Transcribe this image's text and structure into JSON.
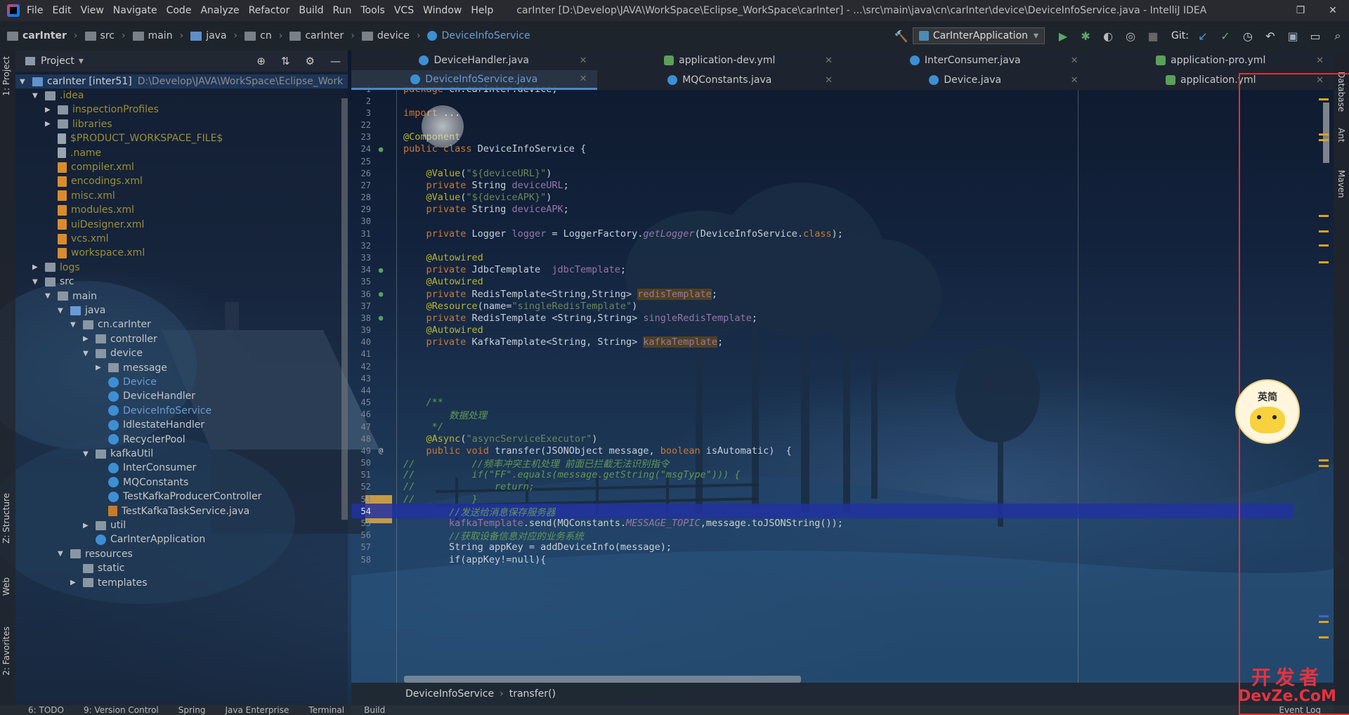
{
  "menu": {
    "items": [
      "File",
      "Edit",
      "View",
      "Navigate",
      "Code",
      "Analyze",
      "Refactor",
      "Build",
      "Run",
      "Tools",
      "VCS",
      "Window",
      "Help"
    ],
    "title": "carInter [D:\\Develop\\JAVA\\WorkSpace\\Eclipse_WorkSpace\\carInter] - ...\\src\\main\\java\\cn\\carInter\\device\\DeviceInfoService.java - IntelliJ IDEA"
  },
  "breadcrumb": [
    "carInter",
    "src",
    "main",
    "java",
    "cn",
    "carInter",
    "device",
    "DeviceInfoService"
  ],
  "toolbar": {
    "run_config": "CarInterApplication",
    "git_label": "Git:"
  },
  "left_tools": {
    "project": "1: Project",
    "structure": "Z: Structure",
    "web": "Web",
    "favorites": "2: Favorites"
  },
  "right_tools": {
    "database": "Database",
    "ant": "Ant",
    "maven": "Maven"
  },
  "project_panel": {
    "title": "Project",
    "root_label": "carInter [inter51]",
    "root_path": "D:\\Develop\\JAVA\\WorkSpace\\Eclipse_Work",
    "tree": [
      {
        "label": ".idea",
        "level": 1,
        "arrow": "▼",
        "icon": "folder",
        "style": "olive"
      },
      {
        "label": "inspectionProfiles",
        "level": 2,
        "arrow": "▶",
        "icon": "folder",
        "style": "olive"
      },
      {
        "label": "libraries",
        "level": 2,
        "arrow": "▶",
        "icon": "folder",
        "style": "olive"
      },
      {
        "label": "$PRODUCT_WORKSPACE_FILE$",
        "level": 2,
        "arrow": "",
        "icon": "file",
        "style": "olive"
      },
      {
        "label": ".name",
        "level": 2,
        "arrow": "",
        "icon": "file",
        "style": "olive"
      },
      {
        "label": "compiler.xml",
        "level": 2,
        "arrow": "",
        "icon": "xml",
        "style": "olive"
      },
      {
        "label": "encodings.xml",
        "level": 2,
        "arrow": "",
        "icon": "xml",
        "style": "olive"
      },
      {
        "label": "misc.xml",
        "level": 2,
        "arrow": "",
        "icon": "xml",
        "style": "olive"
      },
      {
        "label": "modules.xml",
        "level": 2,
        "arrow": "",
        "icon": "xml",
        "style": "olive"
      },
      {
        "label": "uiDesigner.xml",
        "level": 2,
        "arrow": "",
        "icon": "xml",
        "style": "olive"
      },
      {
        "label": "vcs.xml",
        "level": 2,
        "arrow": "",
        "icon": "xml",
        "style": "olive"
      },
      {
        "label": "workspace.xml",
        "level": 2,
        "arrow": "",
        "icon": "xml",
        "style": "olive"
      },
      {
        "label": "logs",
        "level": 1,
        "arrow": "▶",
        "icon": "folder",
        "style": "olive"
      },
      {
        "label": "src",
        "level": 1,
        "arrow": "▼",
        "icon": "folder",
        "style": "plain"
      },
      {
        "label": "main",
        "level": 2,
        "arrow": "▼",
        "icon": "folder",
        "style": "plain"
      },
      {
        "label": "java",
        "level": 3,
        "arrow": "▼",
        "icon": "folder-src",
        "style": "plain"
      },
      {
        "label": "cn.carInter",
        "level": 4,
        "arrow": "▼",
        "icon": "folder",
        "style": "plain"
      },
      {
        "label": "controller",
        "level": 5,
        "arrow": "▶",
        "icon": "folder",
        "style": "plain"
      },
      {
        "label": "device",
        "level": 5,
        "arrow": "▼",
        "icon": "folder",
        "style": "plain"
      },
      {
        "label": "message",
        "level": 6,
        "arrow": "▶",
        "icon": "folder",
        "style": "plain"
      },
      {
        "label": "Device",
        "level": 6,
        "arrow": "",
        "icon": "cls",
        "style": "blue"
      },
      {
        "label": "DeviceHandler",
        "level": 6,
        "arrow": "",
        "icon": "cls",
        "style": "plain"
      },
      {
        "label": "DeviceInfoService",
        "level": 6,
        "arrow": "",
        "icon": "cls",
        "style": "blue"
      },
      {
        "label": "IdlestateHandler",
        "level": 6,
        "arrow": "",
        "icon": "cls",
        "style": "plain"
      },
      {
        "label": "RecyclerPool",
        "level": 6,
        "arrow": "",
        "icon": "cls",
        "style": "plain"
      },
      {
        "label": "kafkaUtil",
        "level": 5,
        "arrow": "▼",
        "icon": "folder",
        "style": "plain"
      },
      {
        "label": "InterConsumer",
        "level": 6,
        "arrow": "",
        "icon": "cls",
        "style": "plain"
      },
      {
        "label": "MQConstants",
        "level": 6,
        "arrow": "",
        "icon": "cls",
        "style": "plain"
      },
      {
        "label": "TestKafkaProducerController",
        "level": 6,
        "arrow": "",
        "icon": "cls",
        "style": "plain"
      },
      {
        "label": "TestKafkaTaskService.java",
        "level": 6,
        "arrow": "",
        "icon": "java",
        "style": "plain"
      },
      {
        "label": "util",
        "level": 5,
        "arrow": "▶",
        "icon": "folder",
        "style": "plain"
      },
      {
        "label": "CarInterApplication",
        "level": 5,
        "arrow": "",
        "icon": "cls",
        "style": "plain"
      },
      {
        "label": "resources",
        "level": 3,
        "arrow": "▼",
        "icon": "folder",
        "style": "plain"
      },
      {
        "label": "static",
        "level": 4,
        "arrow": "",
        "icon": "folder",
        "style": "plain"
      },
      {
        "label": "templates",
        "level": 4,
        "arrow": "▶",
        "icon": "folder",
        "style": "plain"
      }
    ]
  },
  "tabs_row1": [
    {
      "label": "DeviceHandler.java",
      "icon": "cls",
      "active": false
    },
    {
      "label": "application-dev.yml",
      "icon": "yml",
      "active": false
    },
    {
      "label": "InterConsumer.java",
      "icon": "cls",
      "active": false
    },
    {
      "label": "application-pro.yml",
      "icon": "yml",
      "active": false
    }
  ],
  "tabs_row2": [
    {
      "label": "DeviceInfoService.java",
      "icon": "cls",
      "active": true
    },
    {
      "label": "MQConstants.java",
      "icon": "cls",
      "active": false
    },
    {
      "label": "Device.java",
      "icon": "cls",
      "active": false
    },
    {
      "label": "application.yml",
      "icon": "yml",
      "active": false
    }
  ],
  "code_lines": [
    {
      "n": "1",
      "parts": [
        [
          "kw",
          "package "
        ],
        [
          "p",
          "cn.carInter.device;"
        ]
      ]
    },
    {
      "n": "2",
      "parts": []
    },
    {
      "n": "3",
      "parts": [
        [
          "kw",
          "import "
        ],
        [
          "p",
          "..."
        ]
      ]
    },
    {
      "n": "22",
      "parts": []
    },
    {
      "n": "23",
      "parts": [
        [
          "ann",
          "@Component"
        ]
      ]
    },
    {
      "n": "24",
      "parts": [
        [
          "kw",
          "public class "
        ],
        [
          "p",
          "DeviceInfoService {"
        ]
      ],
      "mark": "●"
    },
    {
      "n": "25",
      "parts": []
    },
    {
      "n": "26",
      "parts": [
        [
          "p",
          "    "
        ],
        [
          "ann",
          "@Value"
        ],
        [
          "p",
          "("
        ],
        [
          "str",
          "\"${deviceURL}\""
        ],
        [
          "p",
          ")"
        ]
      ]
    },
    {
      "n": "27",
      "parts": [
        [
          "p",
          "    "
        ],
        [
          "kw",
          "private "
        ],
        [
          "p",
          "String "
        ],
        [
          "fld",
          "deviceURL"
        ],
        [
          "p",
          ";"
        ]
      ]
    },
    {
      "n": "28",
      "parts": [
        [
          "p",
          "    "
        ],
        [
          "ann",
          "@Value"
        ],
        [
          "p",
          "("
        ],
        [
          "str",
          "\"${deviceAPK}\""
        ],
        [
          "p",
          ")"
        ]
      ]
    },
    {
      "n": "29",
      "parts": [
        [
          "p",
          "    "
        ],
        [
          "kw",
          "private "
        ],
        [
          "p",
          "String "
        ],
        [
          "fld",
          "deviceAPK"
        ],
        [
          "p",
          ";"
        ]
      ]
    },
    {
      "n": "30",
      "parts": []
    },
    {
      "n": "31",
      "parts": [
        [
          "p",
          "    "
        ],
        [
          "kw",
          "private "
        ],
        [
          "p",
          "Logger "
        ],
        [
          "fld",
          "logger"
        ],
        [
          "p",
          " = LoggerFactory."
        ],
        [
          "ital",
          "getLogger"
        ],
        [
          "p",
          "(DeviceInfoService."
        ],
        [
          "kw",
          "class"
        ],
        [
          "p",
          ");"
        ]
      ]
    },
    {
      "n": "32",
      "parts": []
    },
    {
      "n": "33",
      "parts": [
        [
          "p",
          "    "
        ],
        [
          "ann",
          "@Autowired"
        ]
      ]
    },
    {
      "n": "34",
      "parts": [
        [
          "p",
          "    "
        ],
        [
          "kw",
          "private "
        ],
        [
          "p",
          "JdbcTemplate  "
        ],
        [
          "fld",
          "jdbcTemplate"
        ],
        [
          "p",
          ";"
        ]
      ],
      "mark": "●"
    },
    {
      "n": "35",
      "parts": [
        [
          "p",
          "    "
        ],
        [
          "ann",
          "@Autowired"
        ]
      ]
    },
    {
      "n": "36",
      "parts": [
        [
          "p",
          "    "
        ],
        [
          "kw",
          "private "
        ],
        [
          "p",
          "RedisTemplate<String,String> "
        ],
        [
          "hl",
          "redisTemplate"
        ],
        [
          "p",
          ";"
        ]
      ],
      "mark": "●"
    },
    {
      "n": "37",
      "parts": [
        [
          "p",
          "    "
        ],
        [
          "ann",
          "@Resource"
        ],
        [
          "p",
          "(name="
        ],
        [
          "str",
          "\"singleRedisTemplate\""
        ],
        [
          "p",
          ")"
        ]
      ]
    },
    {
      "n": "38",
      "parts": [
        [
          "p",
          "    "
        ],
        [
          "kw",
          "private "
        ],
        [
          "p",
          "RedisTemplate <String,String> "
        ],
        [
          "fld",
          "singleRedisTemplate"
        ],
        [
          "p",
          ";"
        ]
      ],
      "mark": "●"
    },
    {
      "n": "39",
      "parts": [
        [
          "p",
          "    "
        ],
        [
          "ann",
          "@Autowired"
        ]
      ]
    },
    {
      "n": "40",
      "parts": [
        [
          "p",
          "    "
        ],
        [
          "kw",
          "private "
        ],
        [
          "p",
          "KafkaTemplate<String, String> "
        ],
        [
          "hl",
          "kafkaTemplate"
        ],
        [
          "p",
          ";"
        ]
      ]
    },
    {
      "n": "41",
      "parts": []
    },
    {
      "n": "42",
      "parts": []
    },
    {
      "n": "43",
      "parts": []
    },
    {
      "n": "44",
      "parts": []
    },
    {
      "n": "45",
      "parts": [
        [
          "p",
          "    "
        ],
        [
          "cmt",
          "/**"
        ]
      ]
    },
    {
      "n": "46",
      "parts": [
        [
          "p",
          "    "
        ],
        [
          "cmt",
          "    数据处理"
        ]
      ]
    },
    {
      "n": "47",
      "parts": [
        [
          "p",
          "    "
        ],
        [
          "cmt",
          " */"
        ]
      ]
    },
    {
      "n": "48",
      "parts": [
        [
          "p",
          "    "
        ],
        [
          "ann",
          "@Async"
        ],
        [
          "p",
          "("
        ],
        [
          "str",
          "\"asyncServiceExecutor\""
        ],
        [
          "p",
          ")"
        ]
      ]
    },
    {
      "n": "49",
      "parts": [
        [
          "p",
          "    "
        ],
        [
          "kw",
          "public void "
        ],
        [
          "p",
          "transfer(JSONObject message, "
        ],
        [
          "kw",
          "boolean "
        ],
        [
          "p",
          "isAutomatic)  {"
        ]
      ],
      "mark": "@"
    },
    {
      "n": "50",
      "parts": [
        [
          "cmt2",
          "//          //频率冲突主机处理 前面已拦截无法识别指令"
        ]
      ]
    },
    {
      "n": "51",
      "parts": [
        [
          "cmt2",
          "//          if(\"FF\".equals(message.getString(\"msgType\"))) {"
        ]
      ]
    },
    {
      "n": "52",
      "parts": [
        [
          "cmt2",
          "//              return;"
        ]
      ]
    },
    {
      "n": "53",
      "parts": [
        [
          "cmt2",
          "//          }"
        ]
      ]
    },
    {
      "n": "54",
      "parts": [
        [
          "p",
          "        "
        ],
        [
          "cmt2",
          "//发送给消息保存服务器"
        ]
      ],
      "current": true
    },
    {
      "n": "55",
      "parts": [
        [
          "p",
          "        "
        ],
        [
          "fld",
          "kafkaTemplate"
        ],
        [
          "p",
          ".send(MQConstants."
        ],
        [
          "ital",
          "MESSAGE_TOPIC"
        ],
        [
          "p",
          ",message.toJSONString());"
        ]
      ]
    },
    {
      "n": "56",
      "parts": [
        [
          "p",
          "        "
        ],
        [
          "cmt2",
          "//获取设备信息对应的业务系统"
        ]
      ]
    },
    {
      "n": "57",
      "parts": [
        [
          "p",
          "        "
        ],
        [
          "p",
          "String appKey = addDeviceInfo(message);"
        ]
      ]
    },
    {
      "n": "58",
      "parts": [
        [
          "p",
          "        "
        ],
        [
          "p",
          "if(appKey!=null){"
        ]
      ]
    }
  ],
  "editor_crumb": [
    "DeviceInfoService",
    "transfer()"
  ],
  "bottom_tabs": [
    "6: TODO",
    "9: Version Control",
    "Spring",
    "Java Enterprise",
    "Terminal",
    "Build",
    "Event Log"
  ],
  "sticker_text": "英简",
  "watermark": {
    "line1": "开发者",
    "line2": "DevZe.CoM"
  }
}
